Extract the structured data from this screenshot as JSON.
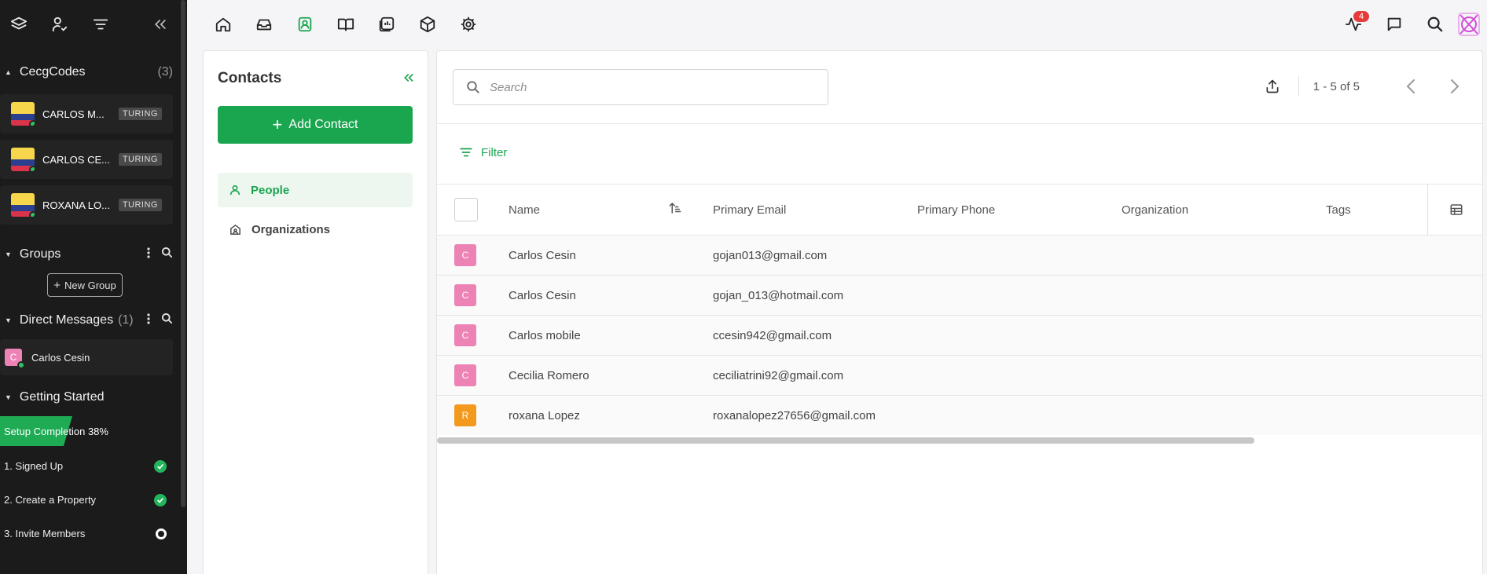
{
  "sidebar": {
    "workspace": {
      "title": "CecgCodes",
      "count": "(3)",
      "channels": [
        {
          "name": "CARLOS MEDINA",
          "display": "CARLOS M...",
          "badge": "TURING"
        },
        {
          "name": "CARLOS CESIN",
          "display": "CARLOS CE...",
          "badge": "TURING"
        },
        {
          "name": "ROXANA LOPEZ",
          "display": "ROXANA LO...",
          "badge": "TURING"
        }
      ]
    },
    "groups": {
      "title": "Groups",
      "new_group_label": "New Group"
    },
    "direct_messages": {
      "title": "Direct Messages",
      "count": "(1)",
      "items": [
        {
          "name": "Carlos Cesin",
          "initial": "C"
        }
      ]
    },
    "getting_started": {
      "title": "Getting Started",
      "setup_label": "Setup Completion 38%",
      "setup_progress": 0.38,
      "steps": [
        {
          "label": "1. Signed Up",
          "status": "done"
        },
        {
          "label": "2. Create a Property",
          "status": "done"
        },
        {
          "label": "3. Invite Members",
          "status": "pending"
        }
      ]
    }
  },
  "topbar": {
    "nav_icons": [
      "home-icon",
      "inbox-icon",
      "contacts-icon",
      "book-icon",
      "reports-icon",
      "box-icon",
      "settings-icon"
    ],
    "active_nav": "contacts-icon",
    "activity_badge": "4"
  },
  "contacts_panel": {
    "title": "Contacts",
    "add_label": "Add Contact",
    "nav": [
      {
        "label": "People",
        "active": true
      },
      {
        "label": "Organizations",
        "active": false
      }
    ]
  },
  "main": {
    "search_placeholder": "Search",
    "pagination": "1 - 5 of 5",
    "filter_label": "Filter",
    "columns": [
      "Name",
      "Primary Email",
      "Primary Phone",
      "Organization",
      "Tags"
    ],
    "rows": [
      {
        "initial": "C",
        "color": "#ec83b4",
        "name": "Carlos Cesin",
        "email": "gojan013@gmail.com"
      },
      {
        "initial": "C",
        "color": "#ec83b4",
        "name": "Carlos Cesin",
        "email": "gojan_013@hotmail.com"
      },
      {
        "initial": "C",
        "color": "#ec83b4",
        "name": "Carlos mobile",
        "email": "ccesin942@gmail.com"
      },
      {
        "initial": "C",
        "color": "#ec83b4",
        "name": "Cecilia Romero",
        "email": "ceciliatrini92@gmail.com"
      },
      {
        "initial": "R",
        "color": "#f39a1e",
        "name": "roxana Lopez",
        "email": "roxanalopez27656@gmail.com"
      }
    ]
  },
  "colors": {
    "accent": "#1aa54f",
    "sidebar_bg": "#1b1b1b",
    "notif": "#e53b3b"
  }
}
